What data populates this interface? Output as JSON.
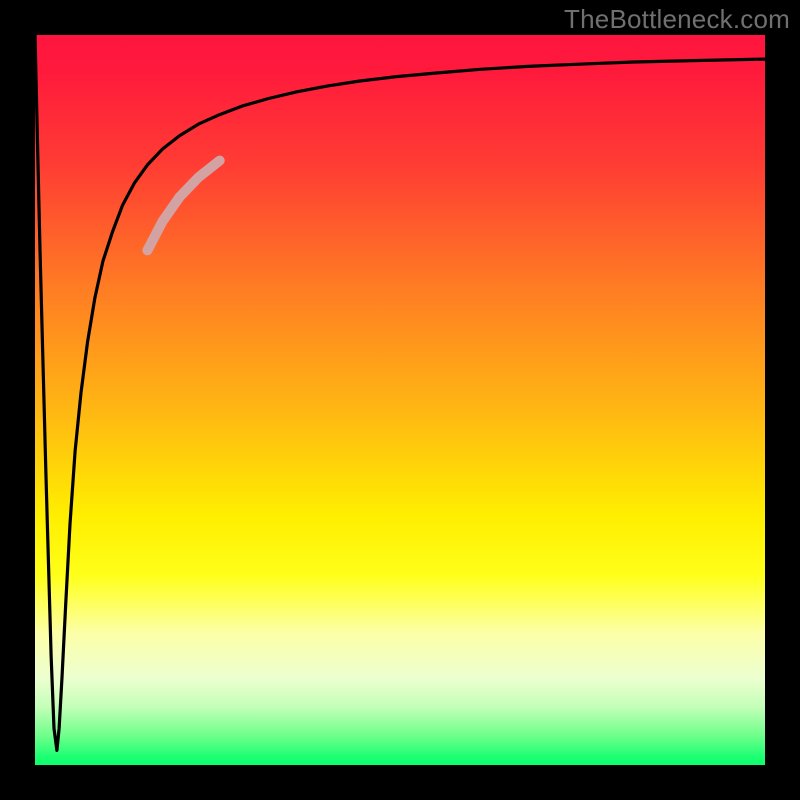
{
  "watermark": "TheBottleneck.com",
  "chart_data": {
    "type": "line",
    "title": "",
    "xlabel": "",
    "ylabel": "",
    "xlim": [
      0,
      100
    ],
    "ylim": [
      0,
      100
    ],
    "series": [
      {
        "name": "bottleneck-curve",
        "x": [
          0.0,
          0.7,
          1.5,
          2.2,
          2.6,
          3.0,
          3.3,
          3.7,
          4.2,
          4.8,
          5.5,
          6.3,
          7.2,
          8.2,
          9.3,
          10.6,
          12.0,
          13.6,
          15.4,
          17.5,
          19.8,
          22.4,
          25.3,
          28.5,
          32.0,
          35.8,
          40.0,
          44.5,
          49.5,
          55.0,
          61.0,
          67.5,
          74.5,
          82.0,
          90.0,
          100.0
        ],
        "y": [
          100.0,
          70.0,
          40.0,
          15.0,
          5.0,
          2.0,
          5.0,
          12.0,
          22.0,
          33.0,
          43.0,
          51.0,
          58.0,
          64.0,
          69.0,
          73.0,
          76.7,
          79.7,
          82.2,
          84.4,
          86.2,
          87.8,
          89.1,
          90.3,
          91.3,
          92.2,
          93.0,
          93.7,
          94.3,
          94.8,
          95.3,
          95.7,
          96.0,
          96.3,
          96.5,
          96.7
        ]
      },
      {
        "name": "highlight-segment",
        "x": [
          15.4,
          17.5,
          19.8,
          22.4,
          25.3
        ],
        "y": [
          70.5,
          74.5,
          77.8,
          80.5,
          82.8
        ]
      }
    ],
    "gradient_stops": [
      {
        "pos": 0.0,
        "color": "#ff153f"
      },
      {
        "pos": 0.18,
        "color": "#ff3d33"
      },
      {
        "pos": 0.34,
        "color": "#ff7a24"
      },
      {
        "pos": 0.52,
        "color": "#ffb912"
      },
      {
        "pos": 0.66,
        "color": "#ffef00"
      },
      {
        "pos": 0.82,
        "color": "#fcffa8"
      },
      {
        "pos": 0.92,
        "color": "#c4ffb9"
      },
      {
        "pos": 1.0,
        "color": "#0aff6c"
      }
    ],
    "colors": {
      "curve": "#000000",
      "highlight": "#d3a3a3",
      "background_frame": "#000000"
    }
  }
}
